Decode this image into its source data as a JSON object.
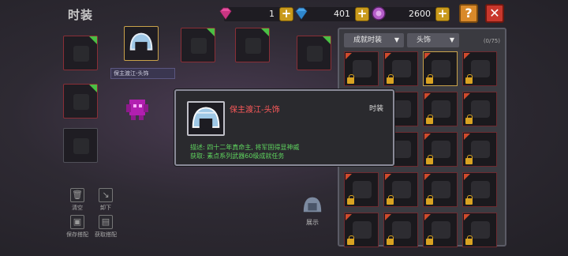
{
  "header": {
    "title": "时装"
  },
  "currencies": [
    {
      "name": "pink-gem",
      "value": "1",
      "color": "#e94fa0"
    },
    {
      "name": "blue-gem",
      "value": "401",
      "color": "#4aa6ea"
    },
    {
      "name": "purple-coin",
      "value": "2600",
      "color": "#b55ec9"
    }
  ],
  "buttons": {
    "help": "?",
    "close": "✕",
    "plus": "+"
  },
  "equip": {
    "selected_label": "保主渡江-头饰"
  },
  "left_actions": [
    {
      "name": "clear",
      "label": "清空"
    },
    {
      "name": "take-off",
      "label": "卸下"
    },
    {
      "name": "save-outfit",
      "label": "保存搭配"
    },
    {
      "name": "load-outfit",
      "label": "获取搭配"
    }
  ],
  "show_button": {
    "label": "展示"
  },
  "panel": {
    "filter_1": "成就时装",
    "filter_2": "头饰",
    "count": "(0/75)"
  },
  "tooltip": {
    "name": "保主渡江-头饰",
    "type": "时装",
    "line1": "描述: 四十二年真命主, 将军固得显神威",
    "line2": "获取: 素点系列武器60级成就任务"
  },
  "colors": {
    "accent_gold": "#c99a1c",
    "lock": "#d9a322",
    "rarity_red": "#8a2e36",
    "desc_green": "#5fd45f"
  }
}
